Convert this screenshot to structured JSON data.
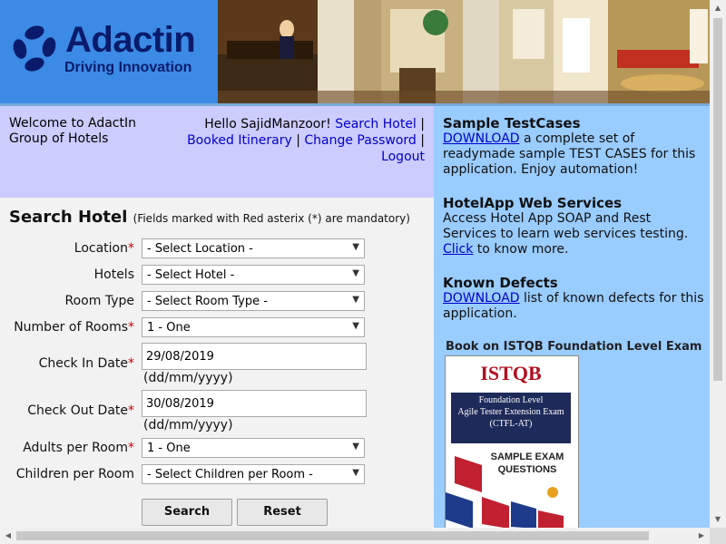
{
  "brand": {
    "name": "Adactin",
    "tagline": "Driving Innovation"
  },
  "welcome": {
    "text": "Welcome to AdactIn Group of Hotels"
  },
  "user_nav": {
    "greeting": "Hello SajidManzoor!",
    "search_hotel": "Search Hotel",
    "booked_itinerary": "Booked Itinerary",
    "change_password": "Change Password",
    "logout": "Logout",
    "separator": "|"
  },
  "search_form": {
    "title": "Search Hotel",
    "note": "(Fields marked with Red asterix (*) are mandatory)",
    "required_mark": "*",
    "location": {
      "label": "Location",
      "value": "- Select Location -"
    },
    "hotels": {
      "label": "Hotels",
      "value": "- Select Hotel -"
    },
    "room_type": {
      "label": "Room Type",
      "value": "- Select Room Type -"
    },
    "number_of_rooms": {
      "label": "Number of Rooms",
      "value": "1 - One"
    },
    "check_in": {
      "label": "Check In Date",
      "value": "29/08/2019",
      "hint": "(dd/mm/yyyy)"
    },
    "check_out": {
      "label": "Check Out Date",
      "value": "30/08/2019",
      "hint": "(dd/mm/yyyy)"
    },
    "adults": {
      "label": "Adults per Room",
      "value": "1 - One"
    },
    "children": {
      "label": "Children per Room",
      "value": "- Select Children per Room -"
    },
    "search_button": "Search",
    "reset_button": "Reset"
  },
  "sidebar": {
    "testcases": {
      "title": "Sample TestCases",
      "link": "DOWNLOAD",
      "text": " a complete set of readymade sample TEST CASES for this application. Enjoy automation!"
    },
    "webservices": {
      "title": "HotelApp Web Services",
      "text": "Access Hotel App SOAP and Rest Services to learn web services testing.",
      "link": "Click",
      "after": " to know more."
    },
    "defects": {
      "title": "Known Defects",
      "link": "DOWNLOAD",
      "text": " list of known defects for this application."
    },
    "book": {
      "title": "Book on ISTQB Foundation Level Exam",
      "cover_title": "ISTQB",
      "cover_sub1": "Foundation Level",
      "cover_sub2": "Agile Tester Extension Exam",
      "cover_sub3": "(CTFL-AT)",
      "cover_sub4": "SAMPLE EXAM",
      "cover_sub5": "QUESTIONS"
    }
  },
  "colors": {
    "header_blue": "#2f77c9",
    "welcome_bg": "#ccccff",
    "sidebar_bg": "#99ccff",
    "link": "#0000cc",
    "required": "#cc0000"
  }
}
